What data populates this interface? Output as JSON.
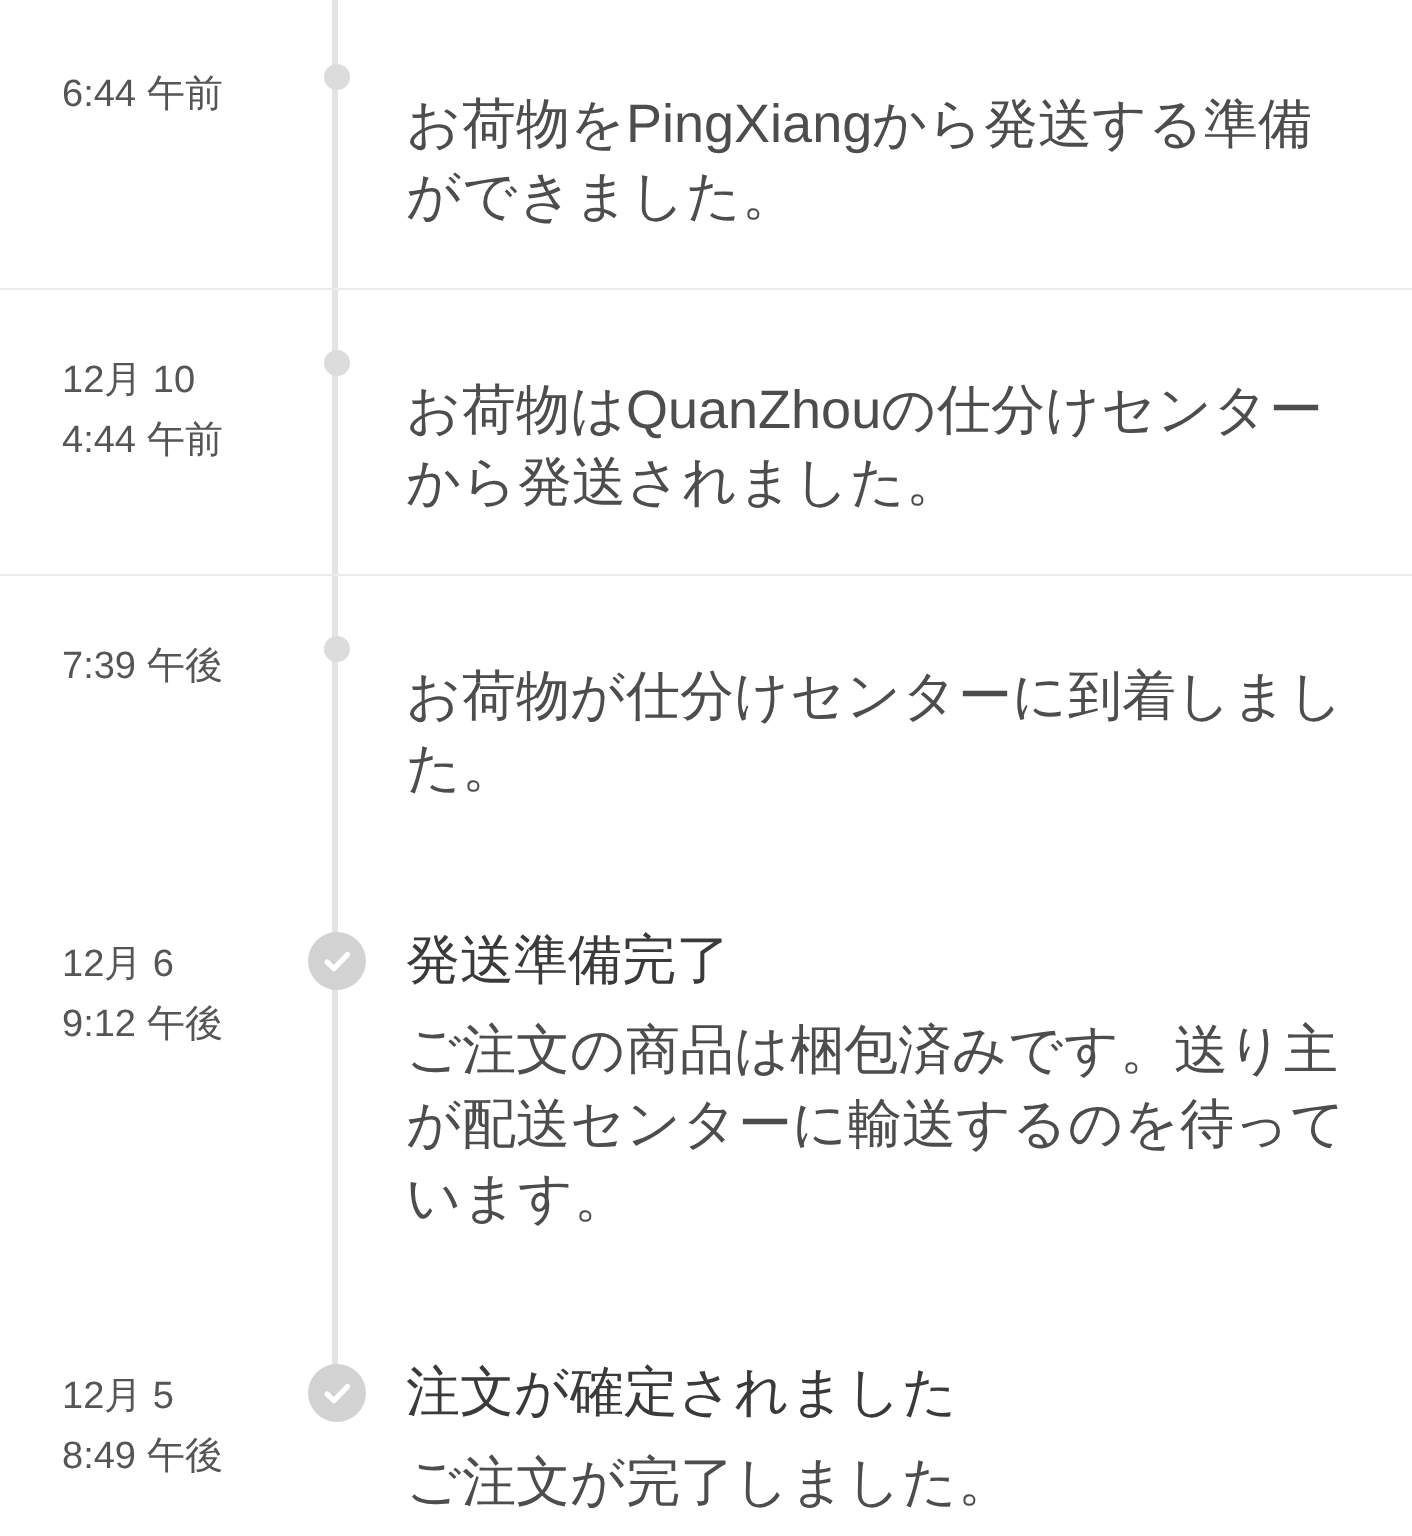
{
  "timeline": [
    {
      "kind": "update",
      "time": "6:44 午前",
      "description": "お荷物をPingXiangから発送する準備ができました。",
      "divider": true
    },
    {
      "kind": "update",
      "date": "12月 10",
      "time": "4:44 午前",
      "description": "お荷物はQuanZhouの仕分けセンターから発送されました。",
      "divider": true
    },
    {
      "kind": "update",
      "time": "7:39 午後",
      "description": "お荷物が仕分けセンターに到着しました。",
      "divider": false
    },
    {
      "kind": "milestone",
      "date": "12月 6",
      "time": "9:12 午後",
      "title": "発送準備完了",
      "description": "ご注文の商品は梱包済みです。送り主が配送センターに輸送するのを待っています。",
      "divider": false
    },
    {
      "kind": "milestone",
      "date": "12月 5",
      "time": "8:49 午後",
      "title": "注文が確定されました",
      "description": "ご注文が完了しました。",
      "divider": false
    }
  ]
}
